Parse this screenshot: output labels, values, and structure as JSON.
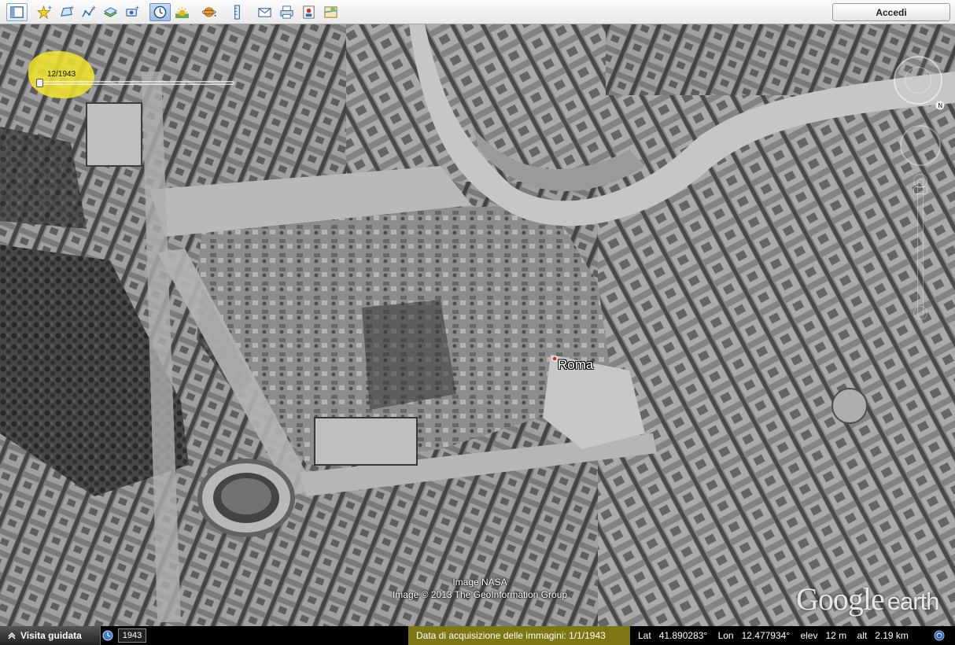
{
  "toolbar": {
    "buttons": [
      {
        "id": "sidebar",
        "icon": "sidebar-icon"
      },
      {
        "id": "placemark",
        "icon": "placemark-add-icon"
      },
      {
        "id": "polygon",
        "icon": "polygon-add-icon"
      },
      {
        "id": "path",
        "icon": "path-add-icon"
      },
      {
        "id": "overlay",
        "icon": "image-overlay-icon"
      },
      {
        "id": "tour",
        "icon": "record-tour-icon"
      },
      {
        "id": "historical",
        "icon": "historical-imagery-icon"
      },
      {
        "id": "sunlight",
        "icon": "sunlight-icon"
      },
      {
        "id": "planets",
        "icon": "planets-icon"
      },
      {
        "id": "ruler",
        "icon": "ruler-icon"
      },
      {
        "id": "email",
        "icon": "email-icon"
      },
      {
        "id": "print",
        "icon": "print-icon"
      },
      {
        "id": "save-image",
        "icon": "save-image-icon"
      },
      {
        "id": "maps",
        "icon": "google-maps-icon"
      }
    ],
    "signin_label": "Accedi"
  },
  "map": {
    "time_slider_date": "12/1943",
    "time_slider_position": 0.0,
    "place_label": "Roma",
    "credits_line1": "Image NASA",
    "credits_line2": "Image © 2013 The GeoInformation Group",
    "brand_google": "Google",
    "brand_earth": "earth"
  },
  "statusbar": {
    "tour_label": "Visita guidata",
    "year": "1943",
    "acquisition": "Data di acquisizione delle immagini: 1/1/1943",
    "lat_label": "Lat",
    "lat_value": "41.890283°",
    "lon_label": "Lon",
    "lon_value": "12.477934°",
    "elev_label": "elev",
    "elev_value": "12 m",
    "alt_label": "alt",
    "alt_value": "2.19 km"
  },
  "colors": {
    "highlight": "#f2e52b",
    "toolbar_bg": "#f2f2f2",
    "active_button": "#a9c5e8"
  }
}
